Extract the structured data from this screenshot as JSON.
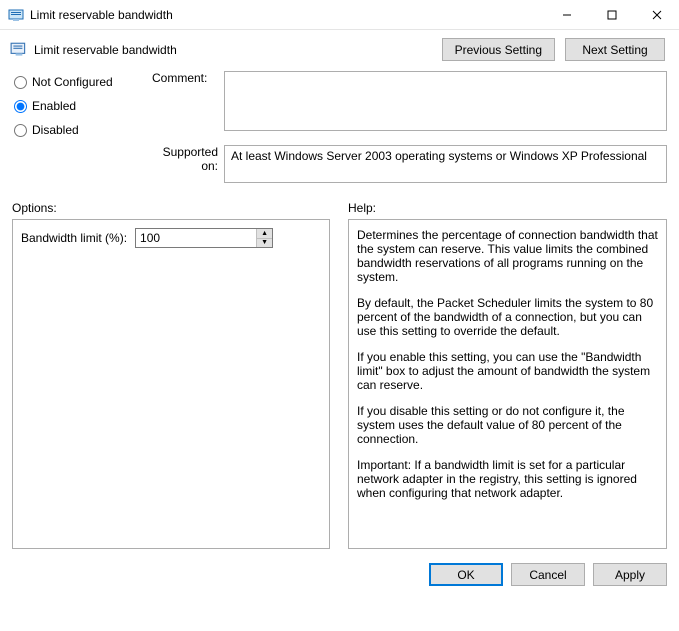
{
  "window": {
    "title": "Limit reservable bandwidth"
  },
  "policy": {
    "title": "Limit reservable bandwidth"
  },
  "nav": {
    "prev": "Previous Setting",
    "next": "Next Setting"
  },
  "state": {
    "not_configured_label": "Not Configured",
    "enabled_label": "Enabled",
    "disabled_label": "Disabled",
    "selected": "enabled"
  },
  "labels": {
    "comment": "Comment:",
    "supported": "Supported on:",
    "options": "Options:",
    "help": "Help:"
  },
  "comment_value": "",
  "supported_text": "At least Windows Server 2003 operating systems or Windows XP Professional",
  "option": {
    "label": "Bandwidth limit (%):",
    "value": "100"
  },
  "help": {
    "p1": "Determines the percentage of connection bandwidth that the system can reserve. This value limits the combined bandwidth reservations of all programs running on the system.",
    "p2": "By default, the Packet Scheduler limits the system to 80 percent of the bandwidth of a connection, but you can use this setting to override the default.",
    "p3": "If you enable this setting, you can use the \"Bandwidth limit\" box to adjust the amount of bandwidth the system can reserve.",
    "p4": "If you disable this setting or do not configure it, the system uses the default value of 80 percent of the connection.",
    "p5": "Important: If a bandwidth limit is set for a particular network adapter in the registry, this setting is ignored when configuring that network adapter."
  },
  "footer": {
    "ok": "OK",
    "cancel": "Cancel",
    "apply": "Apply"
  }
}
